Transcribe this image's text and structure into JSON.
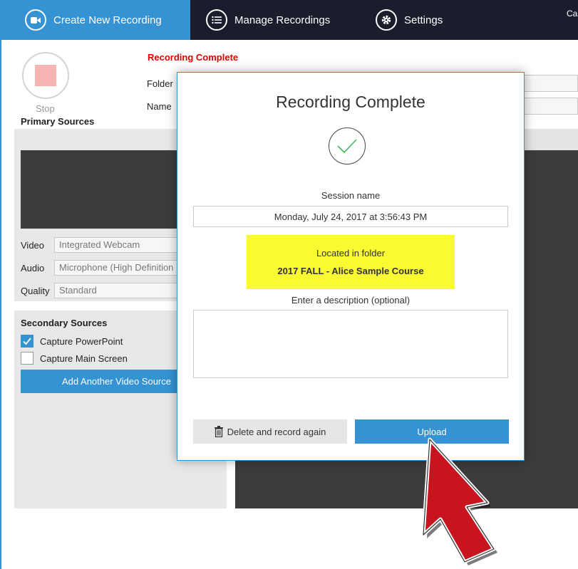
{
  "tabs": [
    {
      "label": "Create New Recording",
      "icon": "video-camera-icon"
    },
    {
      "label": "Manage Recordings",
      "icon": "list-icon"
    },
    {
      "label": "Settings",
      "icon": "gear-icon"
    }
  ],
  "header_cutoff": "Car",
  "recorder": {
    "stop_label": "Stop",
    "status": "Recording Complete",
    "folder_label": "Folder",
    "name_label": "Name"
  },
  "primary": {
    "title": "Primary Sources",
    "video_label": "Video",
    "video_value": "Integrated Webcam",
    "audio_label": "Audio",
    "audio_value": "Microphone (High Definition",
    "quality_label": "Quality",
    "quality_value": "Standard"
  },
  "secondary": {
    "title": "Secondary Sources",
    "capture_powerpoint": "Capture PowerPoint",
    "capture_powerpoint_checked": true,
    "capture_main_screen": "Capture Main Screen",
    "capture_main_screen_checked": false,
    "add_source": "Add Another Video Source"
  },
  "modal": {
    "title": "Recording Complete",
    "session_label": "Session name",
    "session_value": "Monday, July 24, 2017 at 3:56:43 PM",
    "folder_label": "Located in folder",
    "folder_value": "2017 FALL - Alice Sample Course",
    "description_label": "Enter a description (optional)",
    "description_value": "",
    "delete_button": "Delete and record again",
    "upload_button": "Upload"
  },
  "colors": {
    "accent": "#3592d3",
    "topbar": "#1b1d2c",
    "status_red": "#e00000",
    "highlight": "#fafa32",
    "cursor": "#c8141e"
  }
}
